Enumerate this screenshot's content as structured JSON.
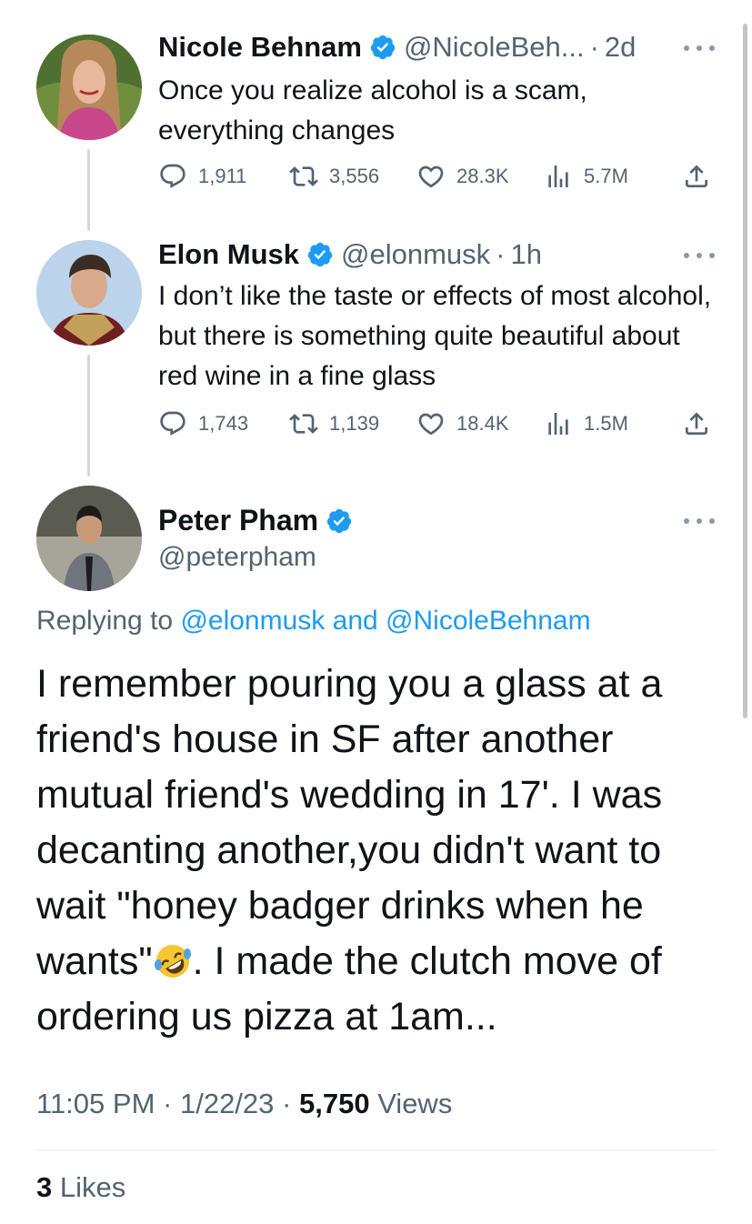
{
  "tweets": [
    {
      "name": "Nicole Behnam",
      "handle": "@NicoleBeh...",
      "time": "2d",
      "text": "Once you realize alcohol is a scam, everything changes",
      "replies": "1,911",
      "retweets": "3,556",
      "likes": "28.3K",
      "views": "5.7M"
    },
    {
      "name": "Elon Musk",
      "handle": "@elonmusk",
      "time": "1h",
      "text": "I don’t like the taste or effects of most alcohol, but there is something quite beautiful about red wine in a fine glass",
      "replies": "1,743",
      "retweets": "1,139",
      "likes": "18.4K",
      "views": "1.5M"
    }
  ],
  "main_tweet": {
    "name": "Peter Pham",
    "handle": "@peterpham",
    "replying_prefix": "Replying to",
    "replying_user1": "@elonmusk",
    "replying_and": "and",
    "replying_user2": "@NicoleBehnam",
    "text_part1": "I remember pouring you a glass at a friend's  house in SF after another mutual friend's wedding in 17'.  I was decanting another,you didn't want to wait \"honey badger drinks when he wants\"",
    "text_part2": ". I made the clutch move of ordering us pizza at 1am...",
    "emoji": "rolling-on-the-floor-laughing",
    "time": "11:05 PM",
    "date": "1/22/23",
    "views_count": "5,750",
    "views_label": "Views",
    "likes_count": "3",
    "likes_label": "Likes"
  },
  "separator": "·",
  "colors": {
    "verified": "#1d9bf0",
    "link": "#1d9bf0",
    "secondary_text": "#536471",
    "thread_line": "#cfd9de"
  },
  "icons": [
    "reply-icon",
    "retweet-icon",
    "like-icon",
    "views-icon",
    "share-icon",
    "verified-badge-icon",
    "more-icon"
  ]
}
